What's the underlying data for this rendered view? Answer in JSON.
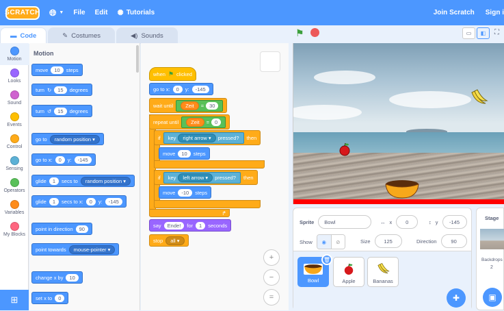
{
  "menubar": {
    "logo": "SCRATCH",
    "file": "File",
    "edit": "Edit",
    "tutorials": "Tutorials",
    "join": "Join Scratch",
    "signin": "Sign i"
  },
  "tabs": {
    "code": "Code",
    "costumes": "Costumes",
    "sounds": "Sounds"
  },
  "categories": [
    "Motion",
    "Looks",
    "Sound",
    "Events",
    "Control",
    "Sensing",
    "Operators",
    "Variables",
    "My Blocks"
  ],
  "category_colors": [
    "#4c97ff",
    "#9966ff",
    "#cf63cf",
    "#ffbf00",
    "#ffab19",
    "#5cb1d6",
    "#59c059",
    "#ff8c1a",
    "#ff6680"
  ],
  "palette": {
    "title": "Motion",
    "move": {
      "a": "move",
      "v": "10",
      "b": "steps"
    },
    "turn_right": {
      "a": "turn",
      "v": "15",
      "b": "degrees"
    },
    "turn_left": {
      "a": "turn",
      "v": "15",
      "b": "degrees"
    },
    "goto_random": {
      "a": "go to",
      "d": "random position ▾"
    },
    "goto_xy": {
      "a": "go to x:",
      "x": "0",
      "y_label": "y:",
      "y": "-145"
    },
    "glide_random": {
      "a": "glide",
      "v": "1",
      "b": "secs to",
      "d": "random position ▾"
    },
    "glide_xy": {
      "a": "glide",
      "v": "1",
      "b": "secs to x:",
      "x": "0",
      "y_label": "y:",
      "y": "-145"
    },
    "point_dir": {
      "a": "point in direction",
      "v": "90"
    },
    "point_towards": {
      "a": "point towards",
      "d": "mouse-pointer ▾"
    },
    "change_x": {
      "a": "change x by",
      "v": "10"
    },
    "set_x": {
      "a": "set x to",
      "v": "0"
    }
  },
  "script": {
    "hat": {
      "a": "when",
      "b": "clicked"
    },
    "goto": {
      "a": "go to x:",
      "x": "0",
      "y_label": "y:",
      "y": "-145"
    },
    "wait": {
      "a": "wait until",
      "op": "Zeit",
      "eq": "=",
      "v": "30"
    },
    "repeat": {
      "a": "repeat until",
      "op": "Zeit",
      "eq": "=",
      "v": "0"
    },
    "if1": {
      "a": "if",
      "key": "key",
      "d": "right arrow ▾",
      "pressed": "pressed?",
      "then": "then",
      "move": "move",
      "v": "10",
      "steps": "steps"
    },
    "if2": {
      "a": "if",
      "key": "key",
      "d": "left arrow ▾",
      "pressed": "pressed?",
      "then": "then",
      "move": "move",
      "v": "-10",
      "steps": "steps"
    },
    "say": {
      "a": "say",
      "v": "Ende!",
      "for": "for",
      "n": "1",
      "secs": "seconds"
    },
    "stop": {
      "a": "stop",
      "d": "all ▾"
    }
  },
  "zoom": {
    "in": "+",
    "out": "−",
    "reset": "="
  },
  "sprite_info": {
    "sprite_label": "Sprite",
    "sprite_name": "Bowl",
    "x_label": "x",
    "x": "0",
    "y_label": "y",
    "y": "-145",
    "show_label": "Show",
    "size_label": "Size",
    "size": "125",
    "direction_label": "Direction",
    "direction": "90"
  },
  "sprites": [
    "Bowl",
    "Apple",
    "Bananas"
  ],
  "stage_panel": {
    "title": "Stage",
    "backdrops_label": "Backdrops",
    "backdrops_count": "2"
  }
}
